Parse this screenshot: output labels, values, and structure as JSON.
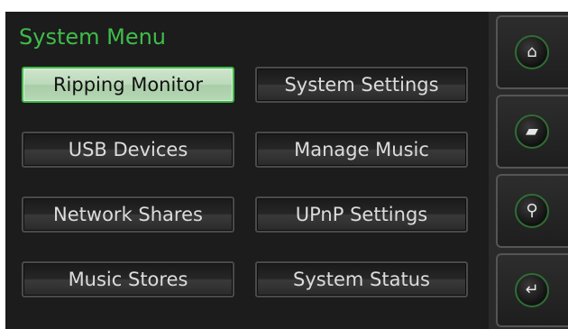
{
  "header": {
    "title": "System Menu"
  },
  "menu": {
    "ripping_monitor": "Ripping Monitor",
    "system_settings": "System Settings",
    "usb_devices": "USB Devices",
    "manage_music": "Manage Music",
    "network_shares": "Network Shares",
    "upnp_settings": "UPnP Settings",
    "music_stores": "Music Stores",
    "system_status": "System Status",
    "selected": "Ripping Monitor"
  },
  "sidebar": {
    "icons": [
      "home-icon",
      "albums-icon",
      "search-icon",
      "back-arrow-icon"
    ],
    "glyphs": {
      "home": "⌂",
      "albums": "▰",
      "search": "⚲",
      "back": "↵"
    }
  },
  "colors": {
    "accent": "#3fbd4a",
    "selected_fill": "#bcd9ba",
    "background": "#1c1c1c"
  }
}
